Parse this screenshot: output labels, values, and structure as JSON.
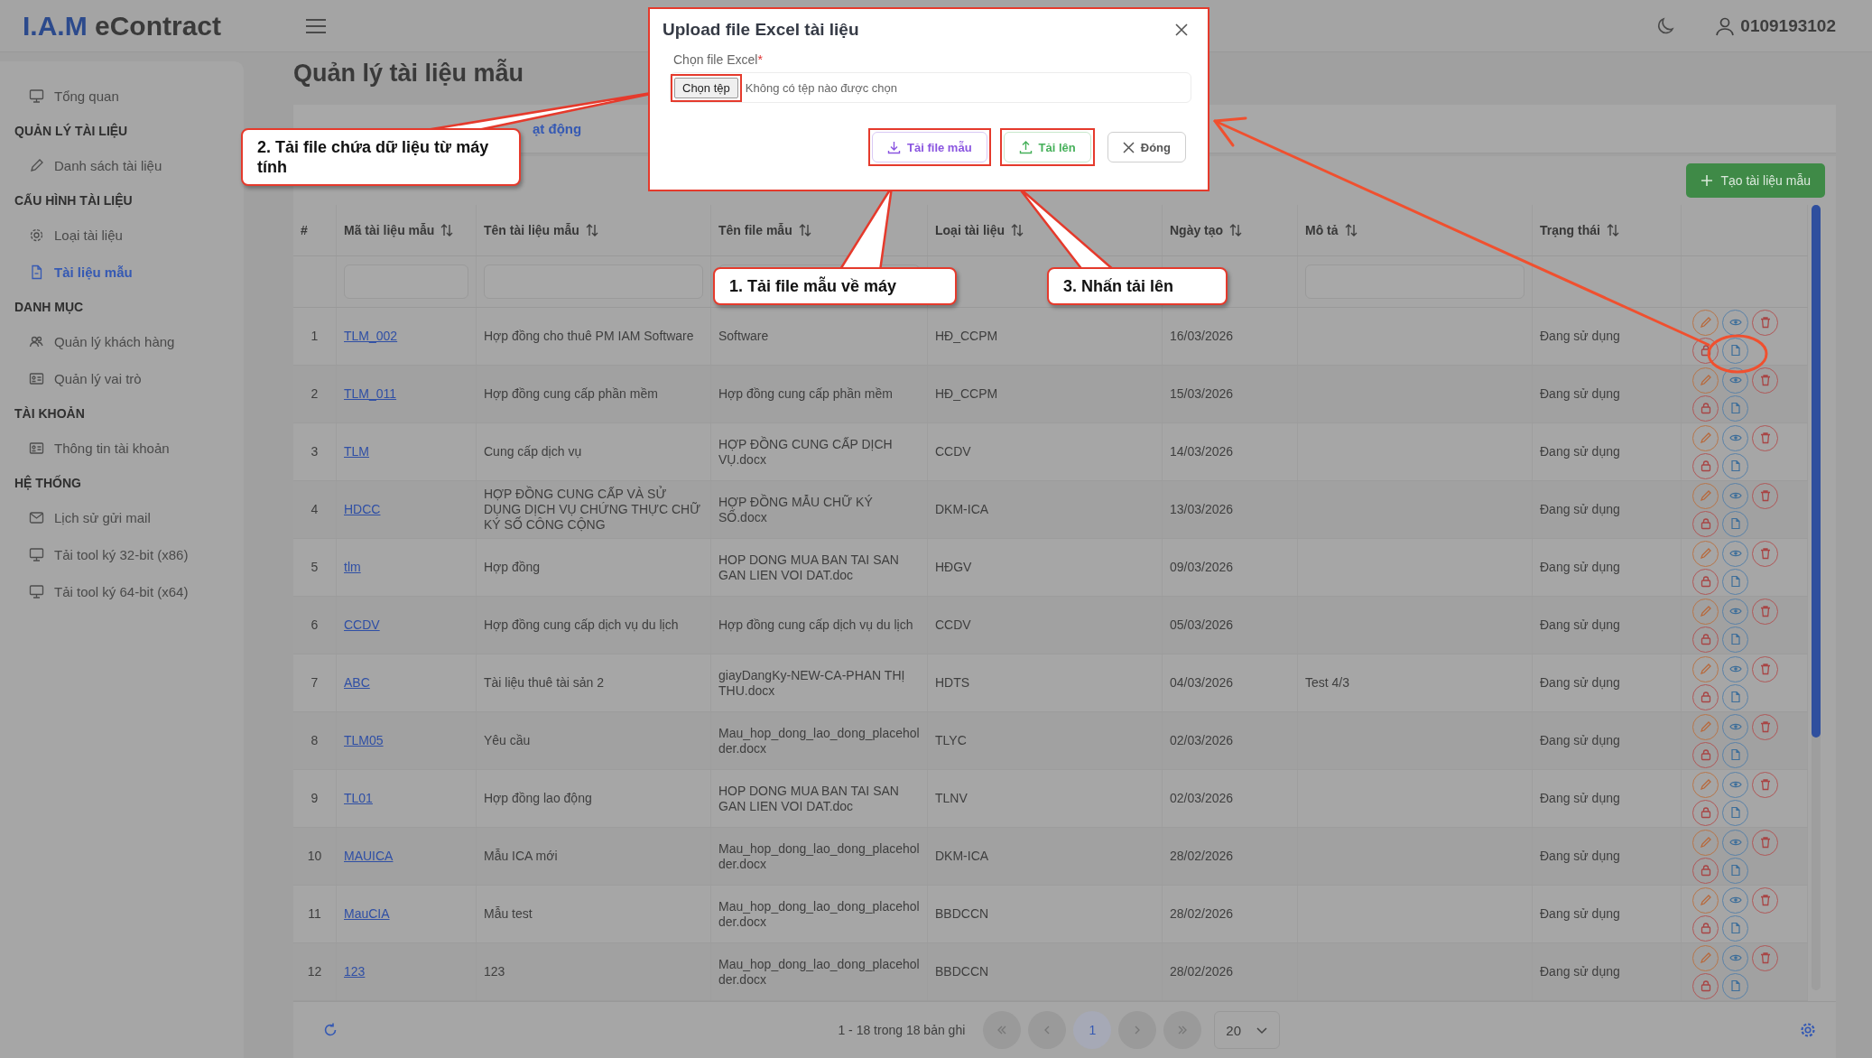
{
  "header": {
    "logo_left": "I.A.M",
    "logo_right": "eContract",
    "user": "0109193102"
  },
  "sidebar": {
    "groups": [
      {
        "items": [
          {
            "label": "Tổng quan",
            "selected": false
          }
        ]
      },
      {
        "title": "QUẢN LÝ TÀI LIỆU",
        "items": [
          {
            "label": "Danh sách tài liệu",
            "selected": false
          }
        ]
      },
      {
        "title": "CẤU HÌNH TÀI LIỆU",
        "items": [
          {
            "label": "Loại tài liệu",
            "selected": false
          },
          {
            "label": "Tài liệu mẫu",
            "selected": true
          }
        ]
      },
      {
        "title": "DANH MỤC",
        "items": [
          {
            "label": "Quản lý khách hàng",
            "selected": false
          },
          {
            "label": "Quản lý vai trò",
            "selected": false
          }
        ]
      },
      {
        "title": "TÀI KHOẢN",
        "items": [
          {
            "label": "Thông tin tài khoản",
            "selected": false
          }
        ]
      },
      {
        "title": "HỆ THỐNG",
        "items": [
          {
            "label": "Lịch sử gửi mail",
            "selected": false
          },
          {
            "label": "Tải tool ký 32-bit (x86)",
            "selected": false
          },
          {
            "label": "Tải tool ký 64-bit (x64)",
            "selected": false
          }
        ]
      }
    ]
  },
  "page_title": "Quản lý tài liệu mẫu",
  "tabs": [
    {
      "label": "ạt động",
      "selected": true
    }
  ],
  "create_button": "Tạo tài liệu mẫu",
  "table": {
    "columns": [
      {
        "label": "#",
        "sortable": false,
        "filter": false
      },
      {
        "label": "Mã tài liệu mẫu",
        "sortable": true,
        "filter": true
      },
      {
        "label": "Tên tài liệu mẫu",
        "sortable": true,
        "filter": true
      },
      {
        "label": "Tên file mẫu",
        "sortable": true,
        "filter": true
      },
      {
        "label": "Loại tài liệu",
        "sortable": true,
        "filter": false
      },
      {
        "label": "Ngày tạo",
        "sortable": true,
        "filter": false
      },
      {
        "label": "Mô tả",
        "sortable": true,
        "filter": true
      },
      {
        "label": "Trạng thái",
        "sortable": true,
        "filter": false
      }
    ],
    "rows": [
      {
        "no": "1",
        "code": "TLM_002",
        "name": "Hợp đồng cho thuê PM IAM Software",
        "file": "Software",
        "type": "HĐ_CCPM",
        "date": "16/03/2026",
        "status": "Đang sử dụng"
      },
      {
        "no": "2",
        "code": "TLM_011",
        "name": "Hợp đồng cung cấp phần mềm",
        "file": "Hợp đồng cung cấp phần mềm",
        "type": "HĐ_CCPM",
        "date": "15/03/2026",
        "status": "Đang sử dụng"
      },
      {
        "no": "3",
        "code": "TLM",
        "name": "Cung cấp dịch vụ",
        "file": "HỢP ĐỒNG CUNG CẤP DỊCH VỤ.docx",
        "type": "CCDV",
        "date": "14/03/2026",
        "status": "Đang sử dụng"
      },
      {
        "no": "4",
        "code": "HDCC",
        "name": "HỢP ĐỒNG CUNG CẤP VÀ SỬ DỤNG DỊCH VỤ CHỨNG THỰC CHỮ KÝ SỐ CÔNG CỘNG",
        "file": "HỢP ĐỒNG MẪU CHỮ KÝ SỐ.docx",
        "type": "DKM-ICA",
        "date": "13/03/2026",
        "status": "Đang sử dụng"
      },
      {
        "no": "5",
        "code": "tlm",
        "name": "Hợp đồng",
        "file": "HOP DONG MUA BAN TAI SAN GAN LIEN VOI DAT.doc",
        "type": "HĐGV",
        "date": "09/03/2026",
        "status": "Đang sử dụng"
      },
      {
        "no": "6",
        "code": "CCDV",
        "name": "Hợp đồng cung cấp dịch vụ du lịch",
        "file": "Hợp đồng cung cấp dịch vụ du lịch",
        "type": "CCDV",
        "date": "05/03/2026",
        "status": "Đang sử dụng"
      },
      {
        "no": "7",
        "code": "ABC",
        "name": "Tài liệu thuê tài sản 2",
        "file": "giayDangKy-NEW-CA-PHAN THỊ THU.docx",
        "type": "HDTS",
        "date": "04/03/2026",
        "desc": "Test 4/3",
        "status": "Đang sử dụng"
      },
      {
        "no": "8",
        "code": "TLM05",
        "name": "Yêu cầu",
        "file": "Mau_hop_dong_lao_dong_placeholder.docx",
        "type": "TLYC",
        "date": "02/03/2026",
        "status": "Đang sử dụng"
      },
      {
        "no": "9",
        "code": "TL01",
        "name": "Hợp đồng lao động",
        "file": "HOP DONG MUA BAN TAI SAN GAN LIEN VOI DAT.doc",
        "type": "TLNV",
        "date": "02/03/2026",
        "status": "Đang sử dụng"
      },
      {
        "no": "10",
        "code": "MAUICA",
        "name": "Mẫu ICA mới",
        "file": "Mau_hop_dong_lao_dong_placeholder.docx",
        "type": "DKM-ICA",
        "date": "28/02/2026",
        "status": "Đang sử dụng"
      },
      {
        "no": "11",
        "code": "MauCIA",
        "name": "Mẫu test",
        "file": "Mau_hop_dong_lao_dong_placeholder.docx",
        "type": "BBDCCN",
        "date": "28/02/2026",
        "status": "Đang sử dụng"
      },
      {
        "no": "12",
        "code": "123",
        "name": "123",
        "file": "Mau_hop_dong_lao_dong_placeholder.docx",
        "type": "BBDCCN",
        "date": "28/02/2026",
        "status": "Đang sử dụng"
      }
    ]
  },
  "footer": {
    "range": "1 - 18 trong 18 bản ghi",
    "pages": [
      {
        "label": "1",
        "selected": true
      }
    ],
    "page_size": "20"
  },
  "modal": {
    "title": "Upload file Excel tài liệu",
    "field_label": "Chọn file Excel",
    "required_mark": "*",
    "choose_button": {
      "label": "Chọn tệp",
      "highlighted": true
    },
    "file_status": "Không có tệp nào được chọn",
    "buttons": [
      {
        "kind": "download",
        "label": "Tải file mẫu",
        "highlighted": true
      },
      {
        "kind": "upload",
        "label": "Tải lên",
        "highlighted": true
      },
      {
        "kind": "close",
        "label": "Đóng",
        "highlighted": false
      }
    ]
  },
  "callouts": [
    {
      "text": "2. Tải file chứa dữ liệu từ máy tính"
    },
    {
      "text": "1. Tải file mẫu về máy"
    },
    {
      "text": "3. Nhấn tải lên"
    }
  ]
}
